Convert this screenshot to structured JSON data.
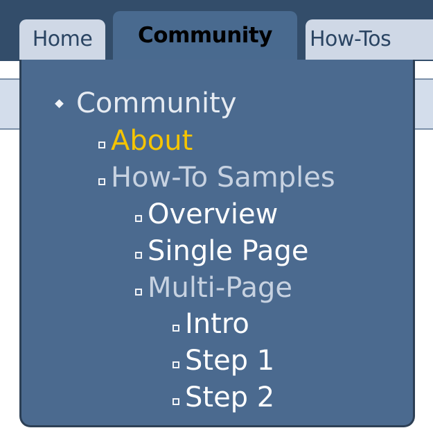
{
  "tabs": [
    {
      "label": "Home",
      "selected": false
    },
    {
      "label": "Community",
      "selected": true
    },
    {
      "label": "How-Tos",
      "selected": false
    }
  ],
  "menu": {
    "root": "Community",
    "items": [
      {
        "label": "About",
        "level": 1,
        "state": "active"
      },
      {
        "label": "How-To Samples",
        "level": 1,
        "state": "muted"
      },
      {
        "label": "Overview",
        "level": 2,
        "state": "normal"
      },
      {
        "label": "Single Page",
        "level": 2,
        "state": "normal"
      },
      {
        "label": "Multi-Page",
        "level": 2,
        "state": "muted"
      },
      {
        "label": "Intro",
        "level": 3,
        "state": "normal"
      },
      {
        "label": "Step 1",
        "level": 3,
        "state": "normal"
      },
      {
        "label": "Step 2",
        "level": 3,
        "state": "normal"
      }
    ]
  },
  "colors": {
    "tabbar_bg": "#334d6a",
    "menu_bg": "#4b6a8f",
    "active_text": "#f5c400",
    "muted_text": "#c7d2e1",
    "normal_text": "#f2f4f8"
  }
}
